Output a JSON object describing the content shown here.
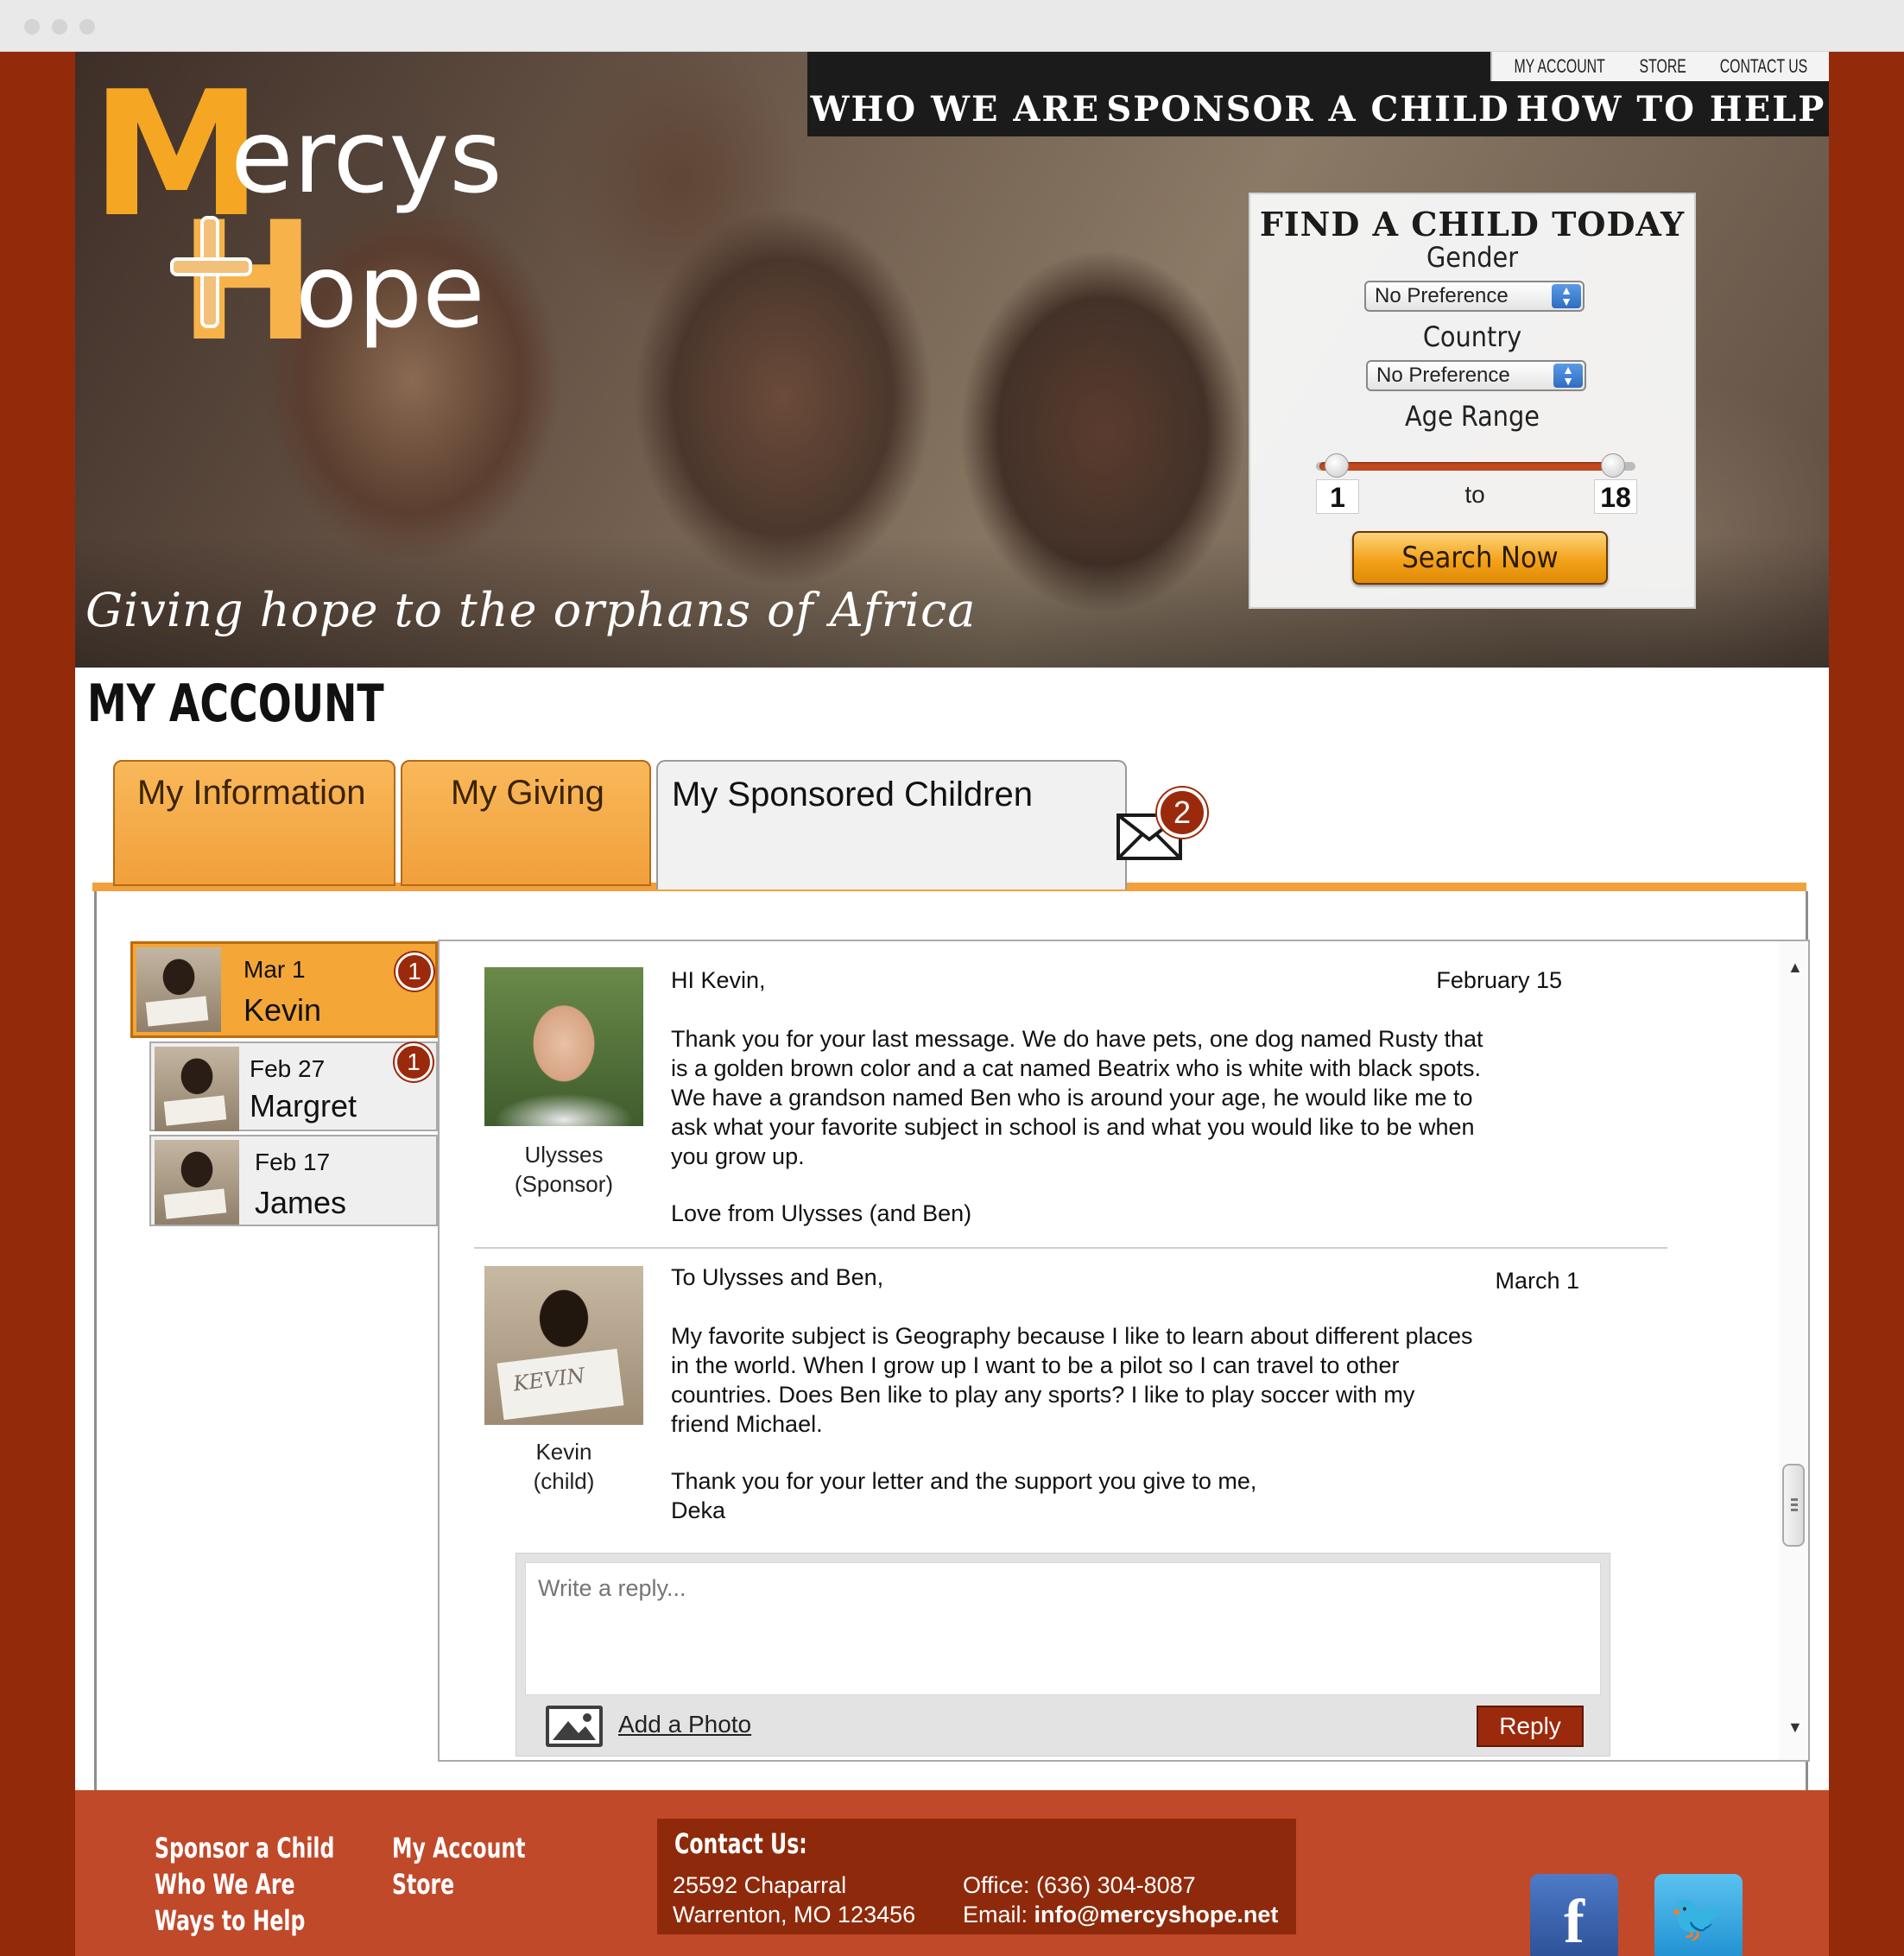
{
  "site": {
    "logo_m": "M",
    "logo_ercys": "ercys",
    "logo_h": "H",
    "logo_ope": "ope",
    "tagline": "Giving hope to the orphans of Africa"
  },
  "utility_nav": [
    "MY ACCOUNT",
    "STORE",
    "CONTACT US"
  ],
  "main_nav": [
    "WHO WE ARE",
    "SPONSOR A CHILD",
    "HOW TO HELP"
  ],
  "finder": {
    "title": "FIND A CHILD TODAY",
    "gender_label": "Gender",
    "gender_value": "No Preference",
    "country_label": "Country",
    "country_value": "No Preference",
    "age_label": "Age Range",
    "age_min": "1",
    "age_to": "to",
    "age_max": "18",
    "search_button": "Search Now"
  },
  "page_title": "MY ACCOUNT",
  "tabs": [
    {
      "label": "My Information",
      "active": false
    },
    {
      "label": "My Giving",
      "active": false
    },
    {
      "label": "My Sponsored Children",
      "active": true,
      "badge": "2"
    }
  ],
  "children": [
    {
      "date": "Mar 1",
      "name": "Kevin",
      "badge": "1",
      "selected": true
    },
    {
      "date": "Feb 27",
      "name": "Margret",
      "badge": "1",
      "selected": false
    },
    {
      "date": "Feb 17",
      "name": "James",
      "badge": "",
      "selected": false
    }
  ],
  "messages": [
    {
      "author": "Ulysses",
      "role": "(Sponsor)",
      "date": "February 15",
      "greeting": "HI Kevin,",
      "lines": [
        "Thank you for your last message. We do have pets, one dog named Rusty that",
        "is a golden brown color and a cat named Beatrix who is white with black spots.",
        "We have a grandson named Ben who is around your age, he would like me to",
        "ask what your favorite subject in school is and what you would like to be when",
        "you grow up."
      ],
      "signoff": "Love from Ulysses (and Ben)"
    },
    {
      "author": "Kevin",
      "role": "(child)",
      "date": "March 1",
      "greeting": "To Ulysses and Ben,",
      "lines": [
        "My favorite subject is Geography because I like to learn about different places",
        "in the world. When I grow up I want to be a pilot so I can travel to other",
        "countries.  Does Ben like to play any sports?  I like to play soccer with my",
        "friend Michael."
      ],
      "signoff_lines": [
        "Thank you for your letter and the support you give to me,",
        "Deka"
      ],
      "sign_text": "KEVIN"
    }
  ],
  "reply": {
    "placeholder": "Write a reply...",
    "add_photo": "Add a Photo",
    "button": "Reply"
  },
  "footer": {
    "col1": [
      "Sponsor a Child",
      "Who We Are",
      "Ways to Help"
    ],
    "col2": [
      "My Account",
      "Store"
    ],
    "contact_title": "Contact Us:",
    "address1": "25592 Chaparral",
    "address2": "Warrenton, MO 123456",
    "office": "Office: (636) 304-8087",
    "email_label": "Email: ",
    "email": "info@mercyshope.net",
    "facebook_glyph": "f",
    "twitter_glyph": "🐦"
  },
  "colors": {
    "brand_red": "#932b0b",
    "accent_orange": "#f1a03b",
    "badge_red": "#9b2a0c",
    "footer_red": "#c0492a"
  }
}
